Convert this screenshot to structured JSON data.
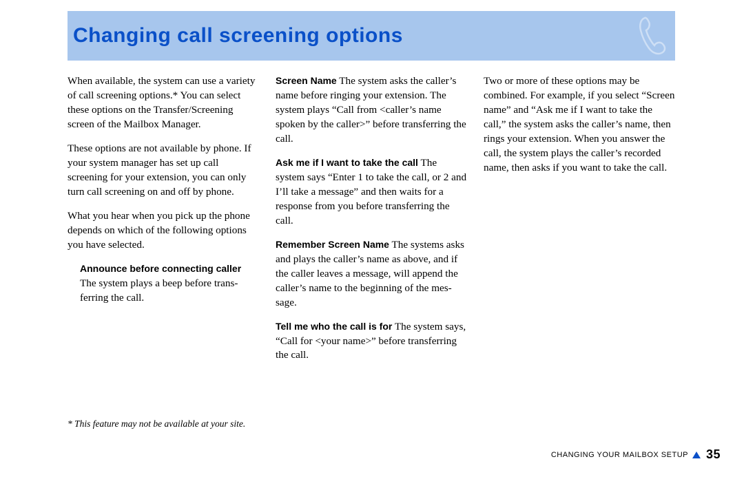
{
  "title": "Changing call screening options",
  "col1": {
    "p1": "When available, the system can use a variety of call screening options.* You can select these options on the Transfer/Screening screen of the Mailbox Man­ager.",
    "p2": "These options are not available by phone. If your system manager has set up call screening for your extension, you can only turn call screening on and off by phone.",
    "p3": "What you hear when you pick up the phone depends on which of the follow­ing options you have selected.",
    "opt1_head": "Announce before connecting caller",
    "opt1_body": "The system plays a beep before trans­ferring the call."
  },
  "col2": {
    "opt2_head": "Screen Name",
    "opt2_body": "  The system asks the caller’s name before ringing your extension. The system plays “Call from <caller’s name spoken by the caller>” before transferring the call.",
    "opt3_head": "Ask me if I want to take the call",
    "opt3_body": "  The system says “Enter 1 to take the call, or 2 and I’ll take a message” and then waits for a response from you before transferring the call.",
    "opt4_head": "Remember Screen Name",
    "opt4_body": "    The sys­tems asks and plays the caller’s name as above, and if the caller leaves a message, will append the caller’s name to the beginning of the mes­sage.",
    "opt5_head": "Tell me who the call is for",
    "opt5_body": "  The sys­tem says, “Call for <your name>” before transferring the call."
  },
  "col3": {
    "p1": "Two or more of these options may be combined. For example, if you select “Screen name” and “Ask me if I want to take the call,” the system asks the caller’s name, then rings your extension. When you answer the call, the system plays the caller’s recorded name, then asks if you want to take the call."
  },
  "footnote": "* This feature may not be available at your site.",
  "footer": {
    "section": "CHANGING YOUR MAILBOX SETUP",
    "page": "35"
  }
}
